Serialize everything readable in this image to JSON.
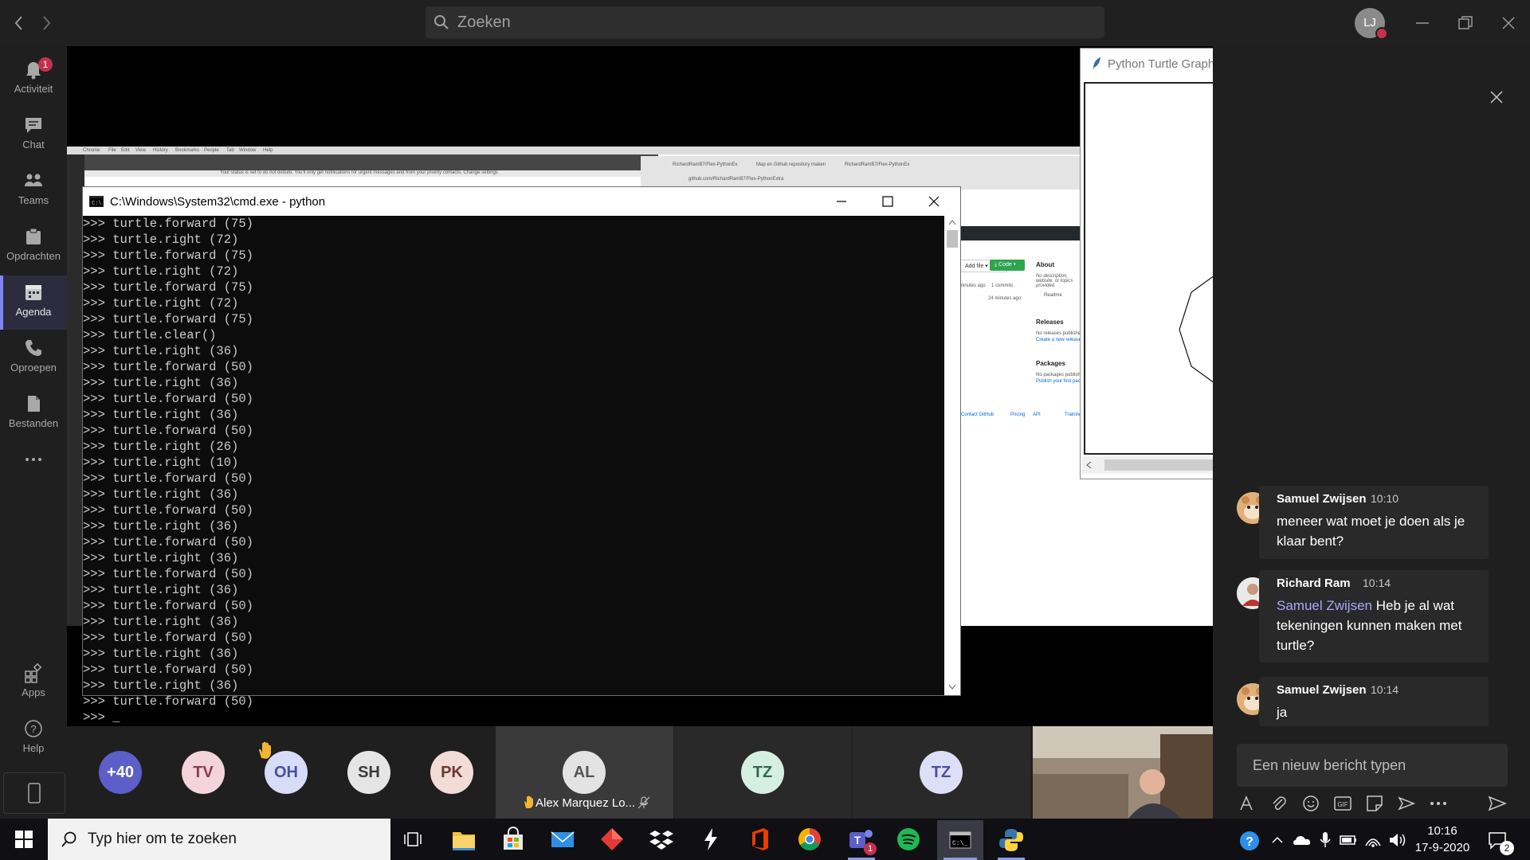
{
  "search": {
    "placeholder": "Zoeken"
  },
  "profile": {
    "initials": "LJ"
  },
  "rail": [
    {
      "label": "Activiteit",
      "badge": "1"
    },
    {
      "label": "Chat"
    },
    {
      "label": "Teams"
    },
    {
      "label": "Opdrachten"
    },
    {
      "label": "Agenda"
    },
    {
      "label": "Oproepen"
    },
    {
      "label": "Bestanden"
    },
    {
      "label": "Apps"
    },
    {
      "label": "Help"
    }
  ],
  "cmd": {
    "title": "C:\\Windows\\System32\\cmd.exe - python",
    "lines": [
      ">>> turtle.forward (75)",
      ">>> turtle.right (72)",
      ">>> turtle.forward (75)",
      ">>> turtle.right (72)",
      ">>> turtle.forward (75)",
      ">>> turtle.right (72)",
      ">>> turtle.forward (75)",
      ">>> turtle.clear()",
      ">>> turtle.right (36)",
      ">>> turtle.forward (50)",
      ">>> turtle.right (36)",
      ">>> turtle.forward (50)",
      ">>> turtle.right (36)",
      ">>> turtle.forward (50)",
      ">>> turtle.right (26)",
      ">>> turtle.right (10)",
      ">>> turtle.forward (50)",
      ">>> turtle.right (36)",
      ">>> turtle.forward (50)",
      ">>> turtle.right (36)",
      ">>> turtle.forward (50)",
      ">>> turtle.right (36)",
      ">>> turtle.forward (50)",
      ">>> turtle.right (36)",
      ">>> turtle.forward (50)",
      ">>> turtle.right (36)",
      ">>> turtle.forward (50)",
      ">>> turtle.right (36)",
      ">>> turtle.forward (50)",
      ">>> turtle.right (36)",
      ">>> turtle.forward (50)",
      ">>> _"
    ]
  },
  "turtle": {
    "title": "Python Turtle Graphics"
  },
  "shared_page": {
    "add_file": "Add file ▾",
    "code_button": "⤓ Code ▾",
    "about_heading": "About",
    "about_text": "No description, website, or topics provided.",
    "readme": "Readme",
    "commits": "1 commits",
    "minutes_ago": "minutes ago",
    "minutes_ago_2": "24 minutes ago",
    "releases_heading": "Releases",
    "releases_text": "No releases published",
    "create_release": "Create a new release",
    "packages_heading": "Packages",
    "packages_text": "No packages published",
    "publish_package": "Publish your first package",
    "footer_links": [
      "Contact GitHub",
      "Pricing",
      "API",
      "Training"
    ],
    "browser_menu": [
      "Chrome",
      "File",
      "Edit",
      "View",
      "History",
      "Bookmarks",
      "People",
      "Tab",
      "Window",
      "Help"
    ],
    "tabs": [
      "RichardRamB7/Flex-PythonEx",
      "Map en Github repository maken",
      "RichardRamB7/Flex-PythonEx"
    ],
    "url": "github.com/RichardRamB7/Flex-PythonExtra",
    "notice": "Your status is set to do not disturb. You'll only get notifications for urgent messages and from your priority contacts. Change settings"
  },
  "messages": [
    {
      "name": "Samuel Zwijsen",
      "time": "10:10",
      "text": "meneer wat moet je doen als je klaar bent?"
    },
    {
      "name": "Richard Ram",
      "time": "10:14",
      "mention": "Samuel Zwijsen",
      "text": " Heb je al wat tekeningen kunnen maken met turtle?"
    },
    {
      "name": "Samuel Zwijsen",
      "time": "10:14",
      "text": "ja"
    }
  ],
  "composer": {
    "placeholder": "Een nieuw bericht typen"
  },
  "participants": [
    {
      "initials": "+40",
      "color": "#5b5fc7",
      "text_color": "#ffffff"
    },
    {
      "initials": "TV",
      "color": "#f4d4dc",
      "text_color": "#8a3a55"
    },
    {
      "initials": "OH",
      "color": "#d8dcf7",
      "text_color": "#4a4f9e",
      "raised_hand": true
    },
    {
      "initials": "SH",
      "color": "#e5e5e5",
      "text_color": "#3b3b3b"
    },
    {
      "initials": "PK",
      "color": "#f1dcd8",
      "text_color": "#6b3a30"
    }
  ],
  "tiles": [
    {
      "initials": "AL",
      "name": "Alex Marquez Lo...",
      "raised_hand": true,
      "muted": true
    },
    {
      "initials": "TZ",
      "color": "#d5f0e3",
      "text_color": "#2d6b4f"
    },
    {
      "initials": "TZ",
      "color": "#dcdff5",
      "text_color": "#4a4f9e"
    }
  ],
  "taskbar": {
    "search_placeholder": "Typ hier om te zoeken",
    "time": "10:16",
    "date": "17-9-2020",
    "notification_count": "2",
    "teams_badge": "1"
  }
}
